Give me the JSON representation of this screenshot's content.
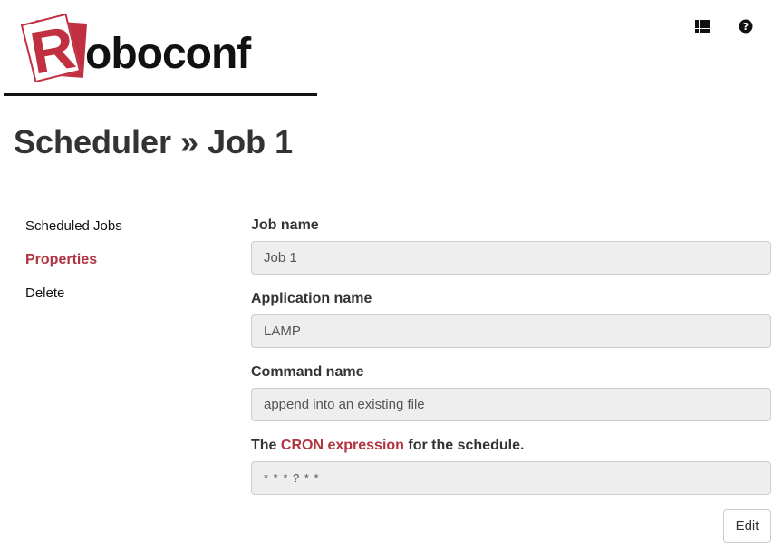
{
  "header": {
    "logo_letter": "R",
    "logo_text": "oboconf",
    "icons": [
      "list-icon",
      "help-icon"
    ]
  },
  "page": {
    "title": "Scheduler » Job 1"
  },
  "sidebar": {
    "items": [
      {
        "label": "Scheduled Jobs",
        "active": false
      },
      {
        "label": "Properties",
        "active": true
      },
      {
        "label": "Delete",
        "active": false
      }
    ]
  },
  "form": {
    "job_name": {
      "label": "Job name",
      "value": "Job 1"
    },
    "application_name": {
      "label": "Application name",
      "value": "LAMP"
    },
    "command_name": {
      "label": "Command name",
      "value": "append into an existing file"
    },
    "cron": {
      "label_prefix": "The ",
      "label_link": "CRON expression",
      "label_suffix": " for the schedule.",
      "value": "* * * ? * *"
    },
    "edit_label": "Edit"
  },
  "colors": {
    "accent": "#b0343f",
    "logo_red": "#c03040",
    "input_background": "#eeeeee"
  }
}
